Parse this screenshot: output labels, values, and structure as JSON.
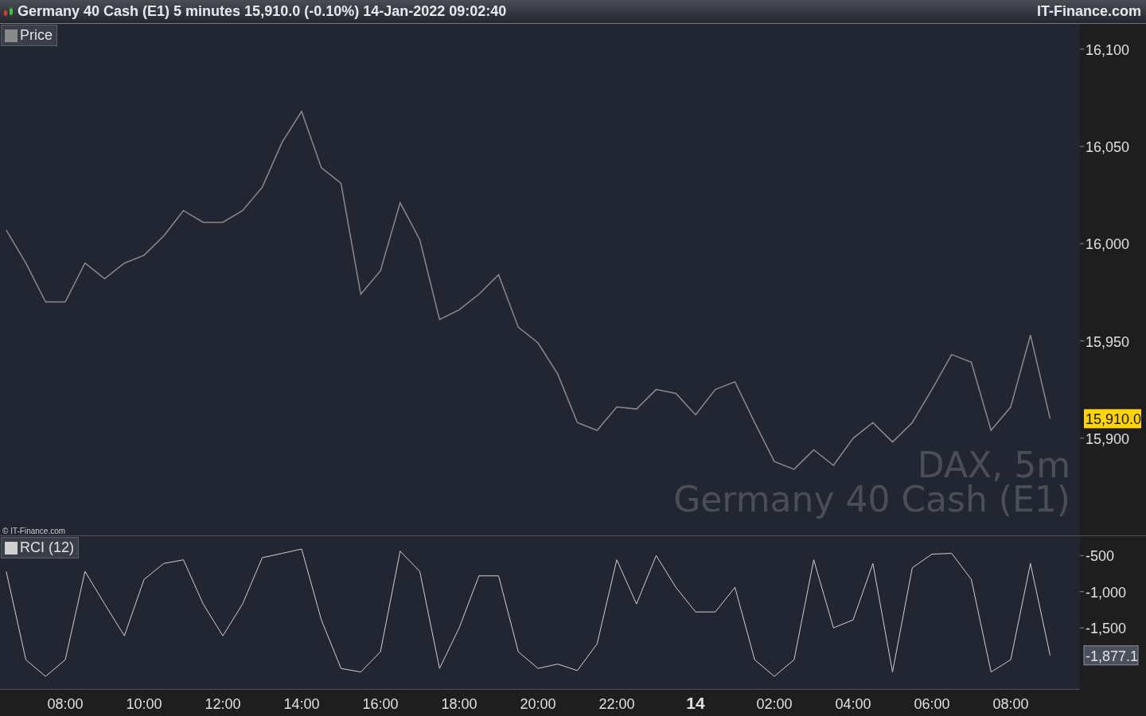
{
  "header": {
    "title": "Germany 40 Cash (E1) 5 minutes 15,910.0 (-0.10%) 14-Jan-2022 09:02:40",
    "brand": "IT-Finance.com"
  },
  "price_pane": {
    "copyright": "© IT-Finance.com",
    "watermark_symbol": "DAX, 5m",
    "watermark_name": "Germany 40 Cash (E1)",
    "last_label": "15,910.0",
    "chart_data": {
      "type": "line",
      "series": [
        {
          "name": "Price",
          "color": "#8a8a8a",
          "values": [
            16007,
            15990,
            15970,
            15970,
            15990,
            15982,
            15990,
            15994,
            16004,
            16017,
            16011,
            16011,
            16017,
            16029,
            16052,
            16068,
            16039,
            16031,
            15974,
            15986,
            16021,
            16002,
            15961,
            15966,
            15974,
            15984,
            15957,
            15949,
            15933,
            15908,
            15904,
            15916,
            15915,
            15925,
            15923,
            15912,
            15925,
            15929,
            15908,
            15888,
            15884,
            15894,
            15886,
            15900,
            15908,
            15898,
            15908,
            15925,
            15943,
            15939,
            15904,
            15916,
            15953,
            15910
          ]
        }
      ],
      "ylim": [
        15850,
        16113
      ],
      "yticks": [
        {
          "value": 15900,
          "label": "15,900"
        },
        {
          "value": 15950,
          "label": "15,950"
        },
        {
          "value": 16000,
          "label": "16,000"
        },
        {
          "value": 16050,
          "label": "16,050"
        },
        {
          "value": 16100,
          "label": "16,100"
        }
      ]
    }
  },
  "rci_pane": {
    "last_label": "-1,877.1",
    "chart_data": {
      "type": "line",
      "categories": [
        null,
        null,
        null,
        "08:00",
        null,
        null,
        null,
        "10:00",
        null,
        null,
        null,
        "12:00",
        null,
        null,
        null,
        "14:00",
        null,
        null,
        null,
        "16:00",
        null,
        null,
        null,
        "18:00",
        null,
        null,
        null,
        "20:00",
        null,
        null,
        null,
        "22:00",
        null,
        null,
        null,
        "14",
        null,
        null,
        null,
        "02:00",
        null,
        null,
        null,
        "04:00",
        null,
        null,
        null,
        "06:00",
        null,
        null,
        null,
        "08:00",
        null,
        null
      ],
      "series": [
        {
          "name": "RCI (12)",
          "color": "#d0d0d0",
          "values": [
            -720,
            -1940,
            -2170,
            -1940,
            -720,
            -1170,
            -1610,
            -830,
            -610,
            -560,
            -1170,
            -1610,
            -1170,
            -530,
            -470,
            -410,
            -1390,
            -2060,
            -2110,
            -1830,
            -440,
            -720,
            -2060,
            -1500,
            -780,
            -780,
            -1830,
            -2060,
            -2000,
            -2090,
            -1720,
            -560,
            -1170,
            -500,
            -940,
            -1280,
            -1280,
            -940,
            -1940,
            -2170,
            -1940,
            -560,
            -1500,
            -1390,
            -610,
            -2110,
            -670,
            -480,
            -470,
            -830,
            -2110,
            -1940,
            -610,
            -1880
          ]
        }
      ],
      "ylim": [
        -2344,
        -233
      ],
      "yticks": [
        {
          "value": -500,
          "label": "-500"
        },
        {
          "value": -1000,
          "label": "-1,000"
        },
        {
          "value": -1500,
          "label": "-1,500"
        }
      ]
    }
  }
}
